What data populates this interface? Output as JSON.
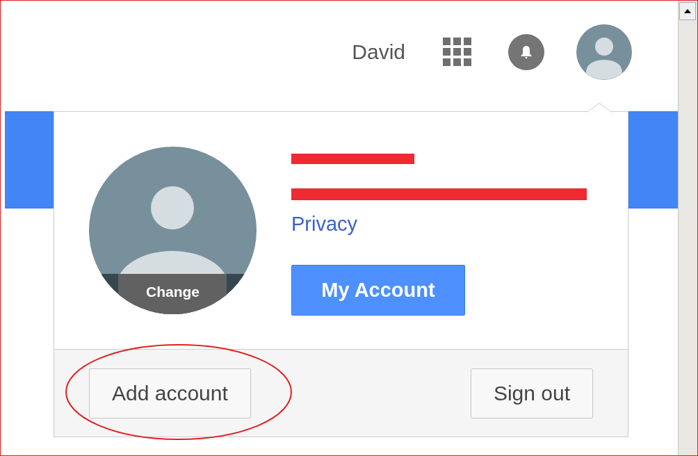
{
  "topbar": {
    "user_name": "David"
  },
  "account_menu": {
    "photo_action": "Change",
    "privacy_link": "Privacy",
    "primary_button": "My Account",
    "footer_buttons": [
      {
        "label": "Add account",
        "circled": true
      },
      {
        "label": "Sign out",
        "circled": false
      }
    ]
  }
}
